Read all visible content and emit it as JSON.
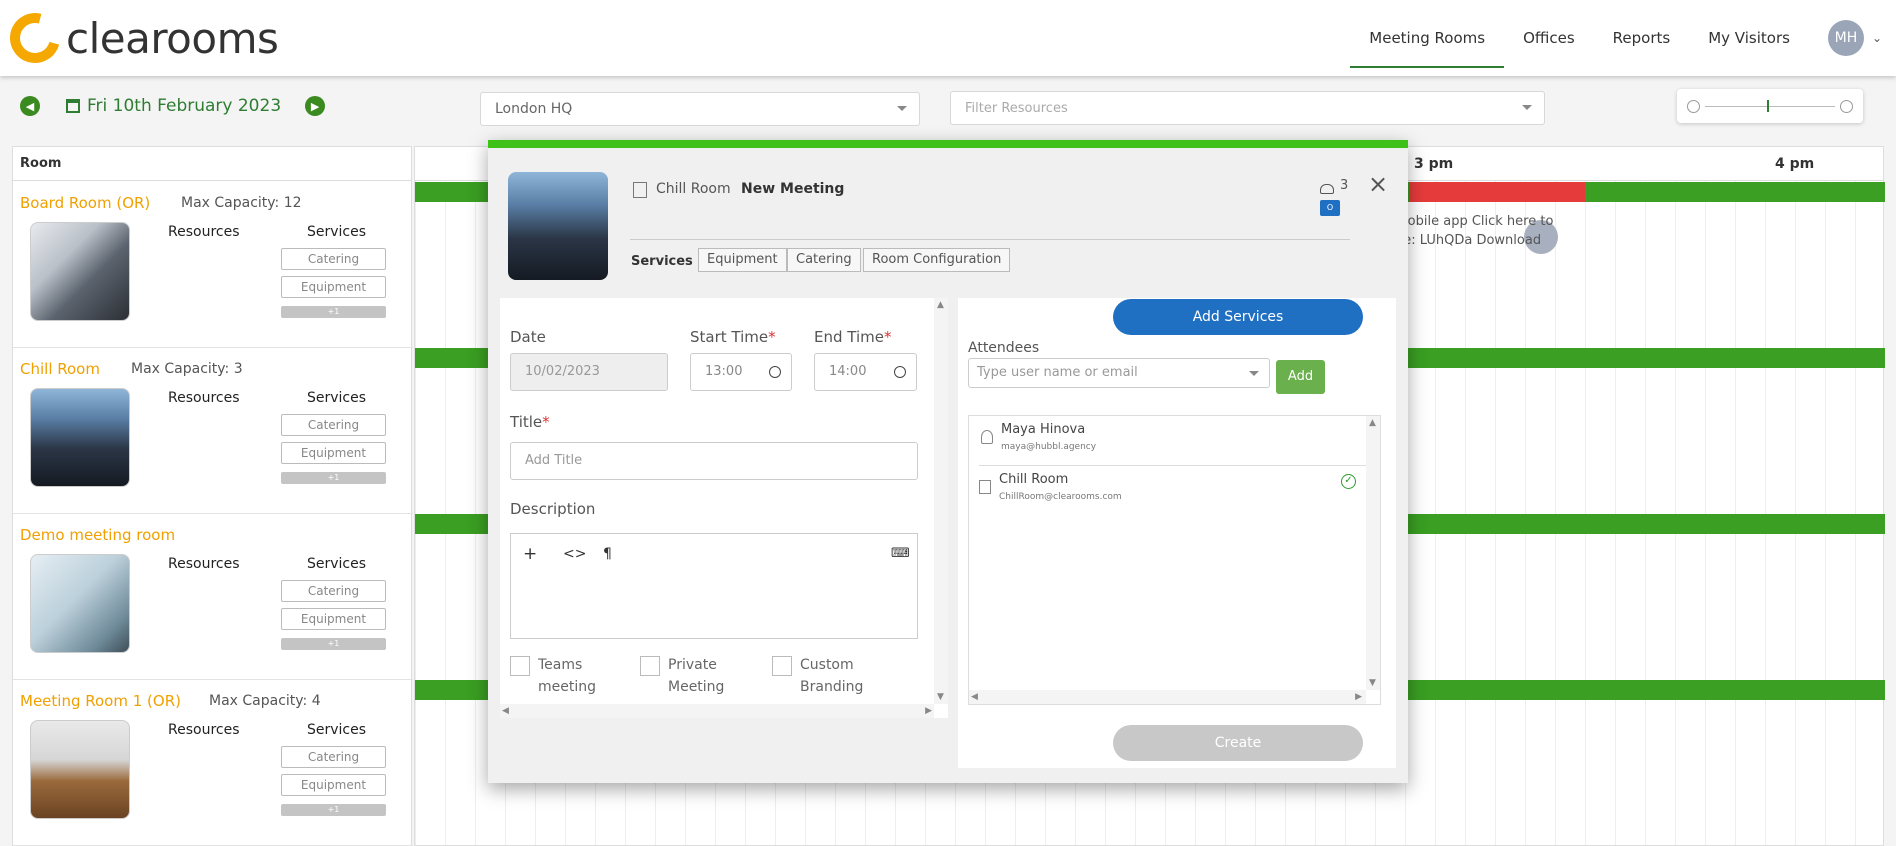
{
  "brand": {
    "name": "clearooms"
  },
  "nav": {
    "items": [
      "Meeting Rooms",
      "Offices",
      "Reports",
      "My Visitors"
    ],
    "avatar": "MH"
  },
  "toolbar": {
    "date": "Fri 10th February 2023",
    "location": "London HQ",
    "filter_placeholder": "Filter Resources"
  },
  "rooms_column": {
    "header": "Room"
  },
  "rooms": [
    {
      "name": "Board Room (OR)",
      "capacity": "Max Capacity: 12",
      "resources": "Resources",
      "services": "Services",
      "btn1": "Catering",
      "btn2": "Equipment",
      "more": "+1"
    },
    {
      "name": "Chill Room",
      "capacity": "Max Capacity: 3",
      "resources": "Resources",
      "services": "Services",
      "btn1": "Catering",
      "btn2": "Equipment",
      "more": "+1"
    },
    {
      "name": "Demo meeting room",
      "capacity": "",
      "resources": "Resources",
      "services": "Services",
      "btn1": "Catering",
      "btn2": "Equipment",
      "more": "+1"
    },
    {
      "name": "Meeting Room 1 (OR)",
      "capacity": "Max Capacity: 4",
      "resources": "Resources",
      "services": "Services",
      "btn1": "Catering",
      "btn2": "Equipment",
      "more": "+1"
    }
  ],
  "timeline": {
    "labels": [
      "3 pm",
      "4 pm"
    ],
    "event_text_1": "mobile app Click here to",
    "event_text_2": "de: LUhQDa Download"
  },
  "modal": {
    "room": "Chill Room",
    "title": "New Meeting",
    "attendee_count": "3",
    "services_label": "Services",
    "tabs": [
      "Equipment",
      "Catering",
      "Room Configuration"
    ],
    "date_label": "Date",
    "date_value": "10/02/2023",
    "start_label": "Start Time",
    "start_value": "13:00",
    "end_label": "End Time",
    "end_value": "14:00",
    "title_label": "Title",
    "title_placeholder": "Add Title",
    "description_label": "Description",
    "checkbox_teams_1": "Teams",
    "checkbox_teams_2": "meeting",
    "checkbox_private_1": "Private",
    "checkbox_private_2": "Meeting",
    "checkbox_custom_1": "Custom",
    "checkbox_custom_2": "Branding",
    "add_services": "Add Services",
    "attendees_label": "Attendees",
    "attendee_placeholder": "Type user name or email",
    "add_button": "Add",
    "attendees": [
      {
        "name": "Maya Hinova",
        "email": "maya@hubbl.agency"
      },
      {
        "name": "Chill Room",
        "email": "ChillRoom@clearooms.com"
      }
    ],
    "create_button": "Create"
  },
  "colors": {
    "accent": "#f0a000",
    "green": "#3a9f22",
    "red": "#e63b3b",
    "blue": "#1f6fc2"
  }
}
